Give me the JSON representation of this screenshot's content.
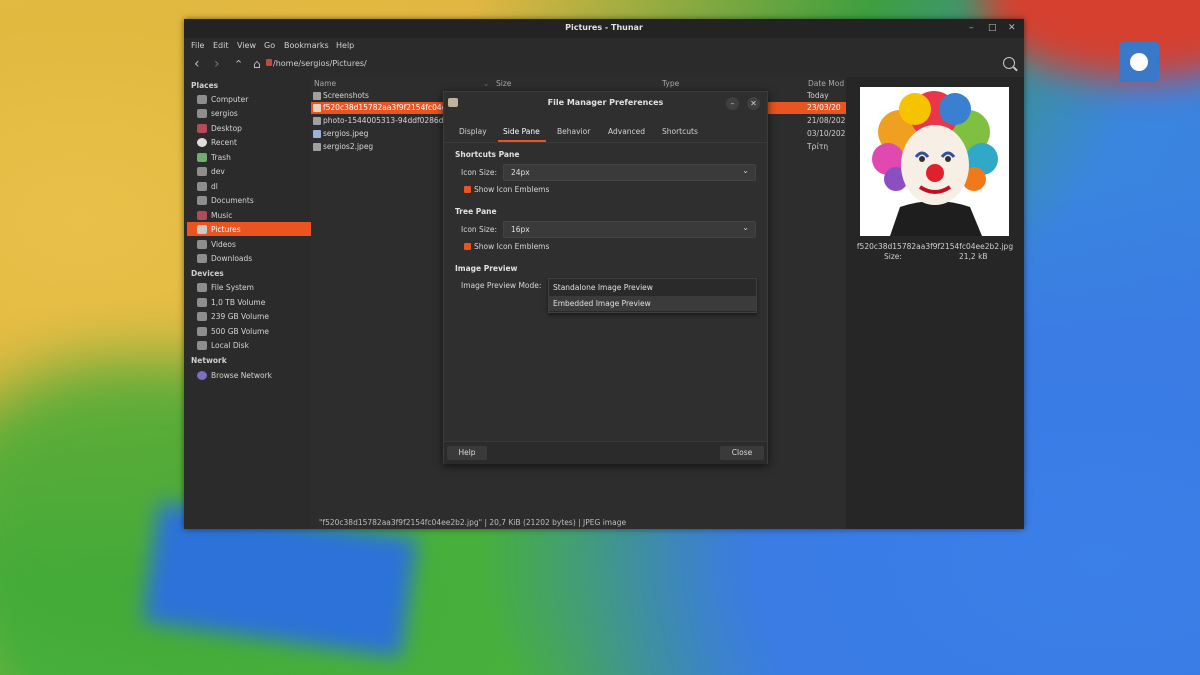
{
  "window": {
    "title": "Pictures - Thunar",
    "min": "–",
    "max": "□",
    "close": "✕"
  },
  "menu": [
    "File",
    "Edit",
    "View",
    "Go",
    "Bookmarks",
    "Help"
  ],
  "toolbar": {
    "path": "/home/sergios/Pictures/"
  },
  "sidebar": {
    "places_title": "Places",
    "places": [
      "Computer",
      "sergios",
      "Desktop",
      "Recent",
      "Trash",
      "dev",
      "dl",
      "Documents",
      "Music",
      "Pictures",
      "Videos",
      "Downloads"
    ],
    "devices_title": "Devices",
    "devices": [
      "File System",
      "1,0 TB Volume",
      "239 GB Volume",
      "500 GB Volume",
      "Local Disk"
    ],
    "network_title": "Network",
    "network": [
      "Browse Network"
    ]
  },
  "columns": {
    "name": "Name",
    "size": "Size",
    "type": "Type",
    "date": "Date Mod"
  },
  "files": [
    {
      "name": "Screenshots",
      "date": "Today"
    },
    {
      "name": "f520c38d15782aa3f9f2154fc04ee2b2.jpg",
      "date": "23/03/20"
    },
    {
      "name": "photo-1544005313-94ddf0286df2.jpg",
      "date": "21/08/202"
    },
    {
      "name": "sergios.jpeg",
      "date": "03/10/202"
    },
    {
      "name": "sergios2.jpeg",
      "date": "Τρίτη"
    }
  ],
  "status": "\"f520c38d15782aa3f9f2154fc04ee2b2.jpg\" | 20,7 KiB (21202 bytes) | JPEG image",
  "preview": {
    "filename": "f520c38d15782aa3f9f2154fc04ee2b2.jpg",
    "size_label": "Size:",
    "size_value": "21,2 kB"
  },
  "dialog": {
    "title": "File Manager Preferences",
    "tabs": [
      "Display",
      "Side Pane",
      "Behavior",
      "Advanced",
      "Shortcuts"
    ],
    "active_tab": "Side Pane",
    "shortcuts_title": "Shortcuts Pane",
    "icon_size_label": "Icon Size:",
    "shortcuts_icon_size": "24px",
    "show_emblems": "Show Icon Emblems",
    "tree_title": "Tree Pane",
    "tree_icon_size": "16px",
    "image_preview_title": "Image Preview",
    "image_preview_mode_label": "Image Preview Mode:",
    "options": [
      "Standalone Image Preview",
      "Embedded Image Preview"
    ],
    "help": "Help",
    "close": "Close"
  },
  "colors": {
    "accent": "#e95420",
    "window_bg": "#2b2b2b"
  }
}
